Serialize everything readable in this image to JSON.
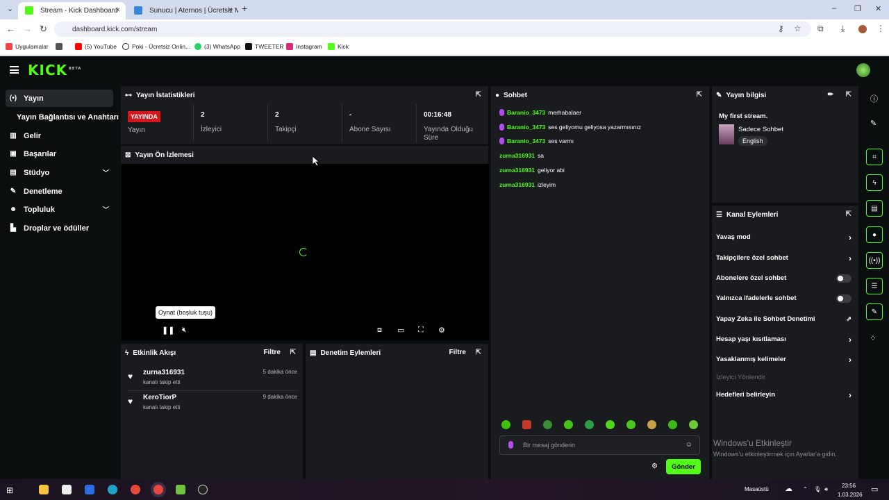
{
  "browser": {
    "tabs": [
      {
        "title": "Stream - Kick Dashboard",
        "active": true
      },
      {
        "title": "Sunucu | Aternos | Ücretsiz Min",
        "active": false
      }
    ],
    "url": "dashboard.kick.com/stream",
    "bookmarks": [
      "Uygulamalar",
      "(5) YouTube",
      "Poki - Ücretsiz Onlin...",
      "(3) WhatsApp",
      "TWEETER",
      "Instagram",
      "Kick"
    ]
  },
  "brand": {
    "logo": "KICK",
    "beta": "BETA",
    "accent": "#53fc18"
  },
  "sidebar": {
    "items": [
      {
        "label": "Yayın",
        "icon": "broadcast-icon"
      },
      {
        "label": "Yayın Bağlantısı ve Anahtarı"
      },
      {
        "label": "Gelir",
        "icon": "chart-icon"
      },
      {
        "label": "Başarılar",
        "icon": "trophy-icon"
      },
      {
        "label": "Stüdyo",
        "icon": "studio-icon"
      },
      {
        "label": "Denetleme",
        "icon": "wrench-icon"
      },
      {
        "label": "Topluluk",
        "icon": "people-icon"
      },
      {
        "label": "Droplar ve ödüller",
        "icon": "gift-icon"
      }
    ]
  },
  "stats": {
    "title": "Yayın İstatistikleri",
    "live_badge": "YAYINDA",
    "live_label": "Yayın",
    "viewers": {
      "value": "2",
      "label": "İzleyici"
    },
    "followers": {
      "value": "2",
      "label": "Takipçi"
    },
    "subs": {
      "value": "-",
      "label": "Abone Sayısı"
    },
    "uptime": {
      "value": "00:16:48",
      "label": "Yayında Olduğu Süre"
    }
  },
  "preview": {
    "title": "Yayın Ön İzlemesi",
    "tooltip": "Oynat (boşluk tuşu)"
  },
  "activity": {
    "title": "Etkinlik Akışı",
    "filter": "Filtre",
    "items": [
      {
        "name": "zurna316931",
        "action": "kanalı takip etti",
        "time": "5 dakika önce"
      },
      {
        "name": "KeroTiorP",
        "action": "kanalı takip etti",
        "time": "9 dakika önce"
      }
    ]
  },
  "moderation": {
    "title": "Denetim Eylemleri",
    "filter": "Filtre"
  },
  "chat": {
    "title": "Sohbet",
    "messages": [
      {
        "user": "Baranio_3473",
        "text": "merhabalaer",
        "badge": true
      },
      {
        "user": "Baranio_3473",
        "text": "ses geliyomu geliyosa yazarmısınız",
        "badge": true
      },
      {
        "user": "Baranio_3473",
        "text": "ses varmı",
        "badge": true
      },
      {
        "user": "zurna316931",
        "text": "sa",
        "badge": false
      },
      {
        "user": "zurna316931",
        "text": "geliyor abi",
        "badge": false
      },
      {
        "user": "zurna316931",
        "text": "izleyim",
        "badge": false
      }
    ],
    "placeholder": "Bir mesaj gönderin",
    "send": "Gönder"
  },
  "info": {
    "title": "Yayın bilgisi",
    "stream_title": "My first stream.",
    "category": "Sadece Sohbet",
    "language": "English"
  },
  "actions": {
    "title": "Kanal Eylemleri",
    "items": [
      {
        "label": "Yavaş mod",
        "control": "chevron"
      },
      {
        "label": "Takipçilere özel sohbet",
        "control": "chevron"
      },
      {
        "label": "Abonelere özel sohbet",
        "control": "toggle"
      },
      {
        "label": "Yalnızca ifadelerle sohbet",
        "control": "toggle"
      },
      {
        "label": "Yapay Zeka ile Sohbet Denetimi",
        "control": "external"
      },
      {
        "label": "Hesap yaşı kısıtlaması",
        "control": "chevron"
      },
      {
        "label": "Yasaklanmış kelimeler",
        "control": "chevron"
      },
      {
        "label": "İzleyici Yönlendir",
        "control": "disabled"
      },
      {
        "label": "Hedefleri belirleyin",
        "control": "chevron"
      }
    ]
  },
  "watermark": {
    "title": "Windows'u Etkinleştir",
    "sub": "Windows'u etkinleştirmek için Ayarlar'a gidin."
  },
  "taskbar": {
    "desktop": "Masaüstü",
    "time": "23:56",
    "date": "1.03.2026"
  }
}
